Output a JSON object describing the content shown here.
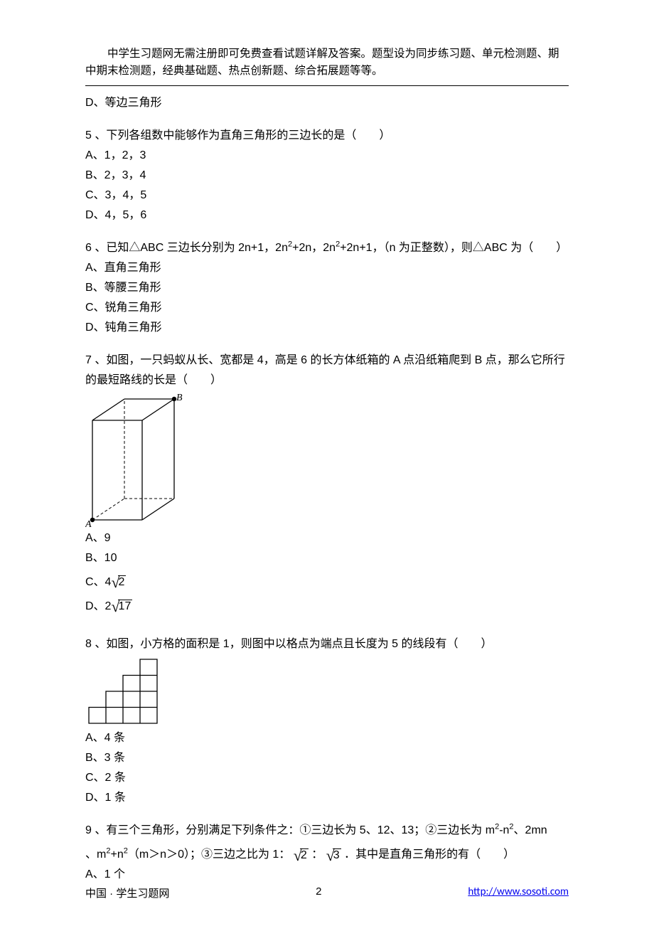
{
  "header": {
    "description": "中学生习题网无需注册即可免费查看试题详解及答案。题型设为同步练习题、单元检测题、期中期末检测题，经典基础题、热点创新题、综合拓展题等等。"
  },
  "prev_tail": {
    "option_d": "D、等边三角形"
  },
  "q5": {
    "stem": "5 、下列各组数中能够作为直角三角形的三边长的是（　　）",
    "a": "A、1，2，3",
    "b": "B、2，3，4",
    "c": "C、3，4，5",
    "d": "D、4，5，6"
  },
  "q6": {
    "stem_pre": "6 、已知△ABC 三边长分别为 2n+1，2n",
    "stem_mid1": "+2n，2n",
    "stem_mid2": "+2n+1，（n 为正整数），则△ABC 为（　　）",
    "a": "A、直角三角形",
    "b": "B、等腰三角形",
    "c": "C、锐角三角形",
    "d": "D、钝角三角形"
  },
  "q7": {
    "stem": "7 、如图，一只蚂蚁从长、宽都是 4，高是 6 的长方体纸箱的 A 点沿纸箱爬到 B 点，那么它所行的最短路线的长是（　　）",
    "label_a": "A",
    "label_b": "B",
    "a": "A、9",
    "b": "B、10",
    "c_pre": "C、4",
    "c_rad": "2",
    "d_pre": "D、2",
    "d_rad": "17"
  },
  "q8": {
    "stem": "8 、如图，小方格的面积是 1，则图中以格点为端点且长度为 5 的线段有（　　）",
    "a": "A、4 条",
    "b": "B、3 条",
    "c": "C、2 条",
    "d": "D、1 条"
  },
  "q9": {
    "stem_pre": "9 、有三个三角形，分别满足下列条件之：①三边长为 5、12、13；②三边长为 m",
    "stem_mid1": "-n",
    "stem_mid2": "、2mn",
    "line2_pre": "、m",
    "line2_mid1": "+n",
    "line2_mid2": "（m＞n＞0）；③三边之比为 1：",
    "line2_r1": "2",
    "line2_mid3": "：",
    "line2_r2": "3",
    "line2_end": "．其中是直角三角形的有（　　）",
    "a": "A、1 个"
  },
  "footer": {
    "left": "中国 · 学生习题网",
    "page": "2",
    "url": "http://www.sosoti.com"
  },
  "chart_data": [
    {
      "type": "diagram",
      "description": "Rectangular cuboid (box), length 4, width 4, height 6. Point A at front-bottom-left vertex, point B at back-top-right vertex.",
      "dimensions": {
        "length": 4,
        "width": 4,
        "height": 6
      },
      "points": {
        "A": "front-bottom-left",
        "B": "back-top-right"
      }
    },
    {
      "type": "diagram",
      "description": "Staircase figure on a unit grid: bottom row of 4 unit squares, a row of 3 unit squares on top aligned right, a row of 2 unit squares on top of that aligned right, and 1 unit square on top aligned right. Each small square has area 1.",
      "row_widths_bottom_to_top": [
        4,
        3,
        2,
        1
      ],
      "unit_area": 1
    }
  ]
}
